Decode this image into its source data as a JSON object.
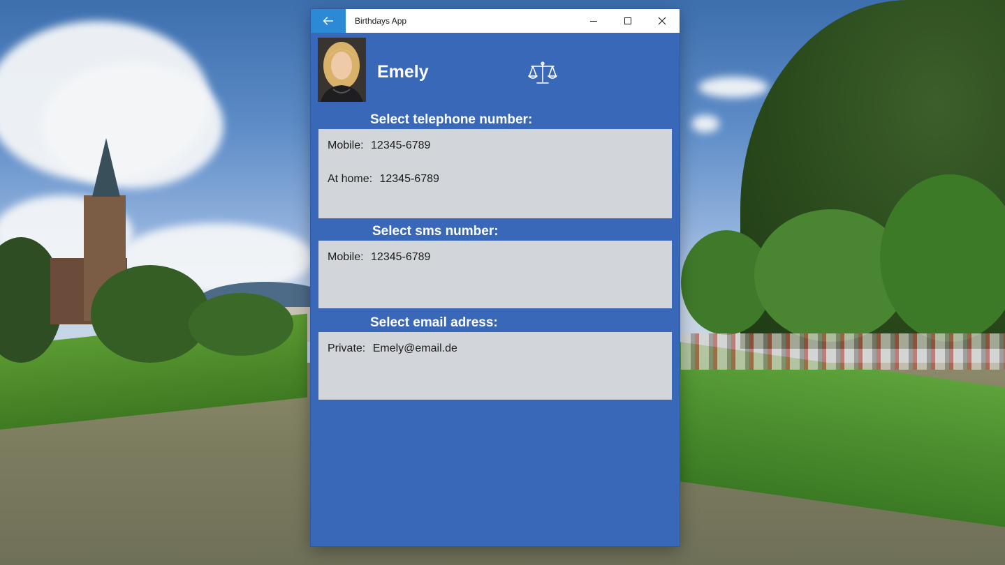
{
  "window": {
    "title": "Birthdays App",
    "back_icon": "arrow-left-icon",
    "minimize_icon": "minimize-icon",
    "maximize_icon": "maximize-icon",
    "close_icon": "close-icon",
    "background_color": "#3a68b8",
    "accent_color": "#2c89d6"
  },
  "contact": {
    "name": "Emely",
    "photo_icon": "contact-photo",
    "action_icon": "scales-icon"
  },
  "telephone": {
    "heading": "Select telephone number:",
    "items": [
      {
        "label": "Mobile:",
        "value": "12345-6789"
      },
      {
        "label": "At home:",
        "value": "12345-6789"
      }
    ]
  },
  "sms": {
    "heading": "Select sms number:",
    "items": [
      {
        "label": "Mobile:",
        "value": "12345-6789"
      }
    ]
  },
  "email": {
    "heading": "Select email adress:",
    "items": [
      {
        "label": "Private:",
        "value": "Emely@email.de"
      }
    ]
  }
}
